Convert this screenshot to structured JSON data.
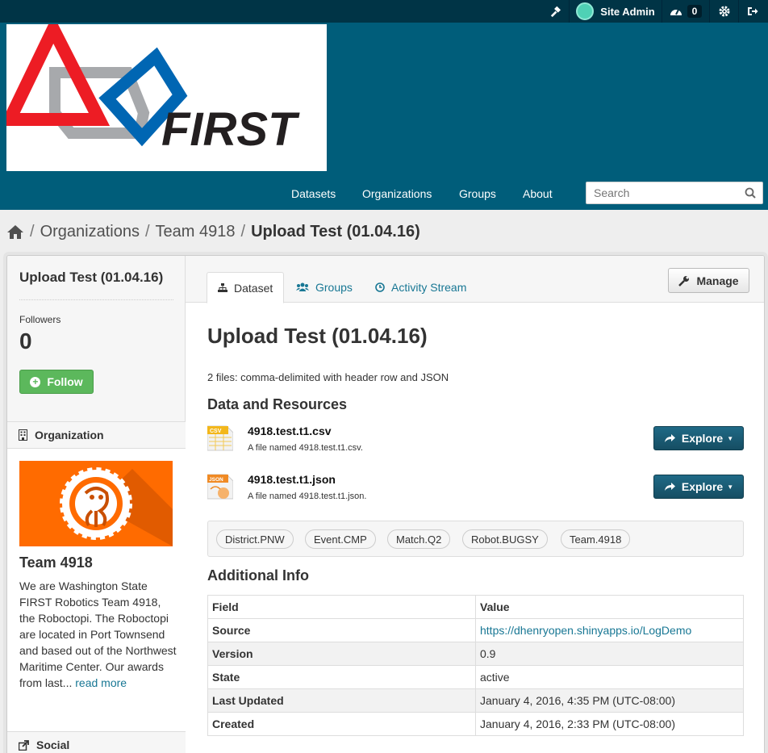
{
  "account": {
    "user_name": "Site Admin",
    "dashboard_count": "0"
  },
  "nav": {
    "items": [
      "Datasets",
      "Organizations",
      "Groups",
      "About"
    ],
    "search_placeholder": "Search"
  },
  "logo": {
    "text": "FIRST"
  },
  "breadcrumb": {
    "items": [
      "Organizations",
      "Team 4918",
      "Upload Test (01.04.16)"
    ],
    "divider": "/"
  },
  "sidebar": {
    "dataset_title": "Upload Test (01.04.16)",
    "followers_label": "Followers",
    "followers_count": "0",
    "follow_label": "Follow",
    "organization_heading": "Organization",
    "org_name": "Team 4918",
    "org_description": "We are Washington State FIRST Robotics Team 4918, the Roboctopi. The Roboctopi are located in Port Townsend and based out of the Northwest Maritime Center. Our awards from last...",
    "read_more": "read more",
    "social_heading": "Social"
  },
  "tabs": [
    "Dataset",
    "Groups",
    "Activity Stream"
  ],
  "manage_label": "Manage",
  "dataset": {
    "title": "Upload Test (01.04.16)",
    "notes": "2 files: comma-delimited with header row and JSON",
    "resources_heading": "Data and Resources",
    "resources": [
      {
        "name": "4918.test.t1.csv",
        "description": "A file named 4918.test.t1.csv.",
        "format": "CSV"
      },
      {
        "name": "4918.test.t1.json",
        "description": "A file named 4918.test.t1.json.",
        "format": "JSON"
      }
    ],
    "explore_label": "Explore",
    "tags": [
      "District.PNW",
      "Event.CMP",
      "Match.Q2",
      "Robot.BUGSY",
      "Team.4918"
    ],
    "additional_info_heading": "Additional Info",
    "info_headers": [
      "Field",
      "Value"
    ],
    "info_rows": [
      {
        "field": "Source",
        "value": "https://dhenryopen.shinyapps.io/LogDemo"
      },
      {
        "field": "Version",
        "value": "0.9"
      },
      {
        "field": "State",
        "value": "active"
      },
      {
        "field": "Last Updated",
        "value": "January 4, 2016, 4:35 PM (UTC-08:00)"
      },
      {
        "field": "Created",
        "value": "January 4, 2016, 2:33 PM (UTC-08:00)"
      }
    ]
  },
  "colors": {
    "masthead": "#005d7a",
    "account_bar": "#003446",
    "accent_link": "#187794",
    "follow_green": "#5cb85c",
    "explore_blue": "#1b5d76",
    "org_orange": "#ff6b00"
  }
}
